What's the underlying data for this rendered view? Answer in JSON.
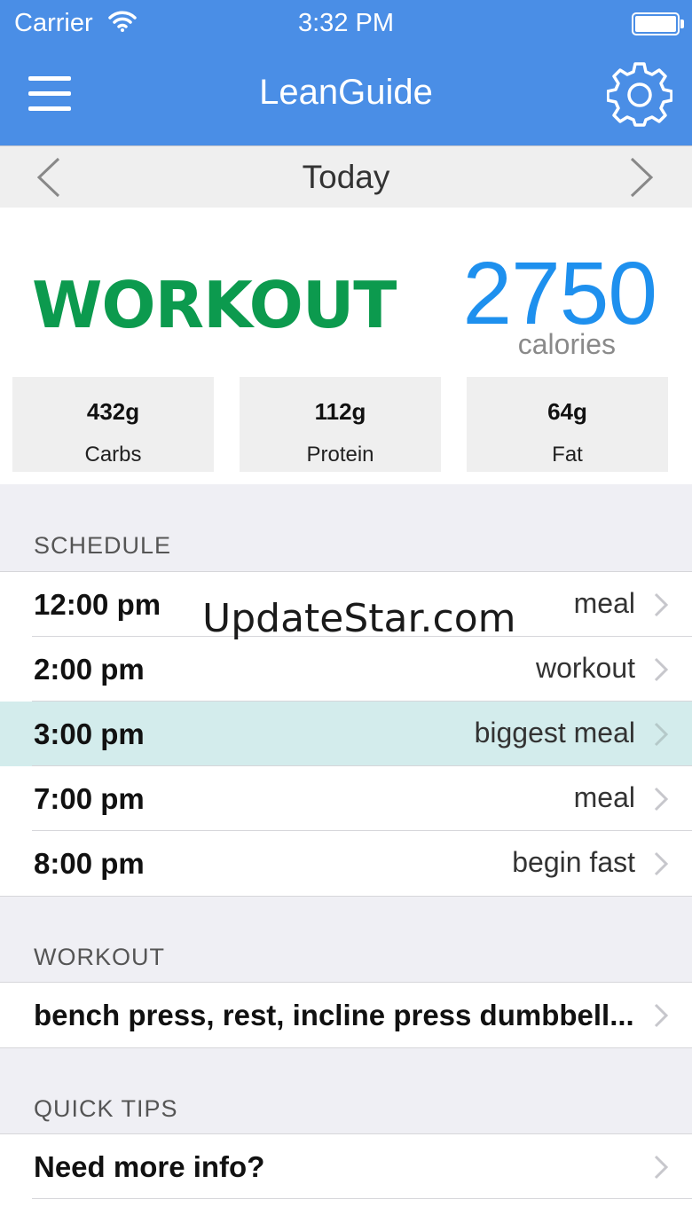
{
  "status_bar": {
    "carrier": "Carrier",
    "time": "3:32 PM"
  },
  "nav": {
    "title": "LeanGuide"
  },
  "date_bar": {
    "label": "Today"
  },
  "summary": {
    "mode": "WORKOUT",
    "calories_value": "2750",
    "calories_unit": "calories",
    "macros": [
      {
        "amount": "432g",
        "name": "Carbs"
      },
      {
        "amount": "112g",
        "name": "Protein"
      },
      {
        "amount": "64g",
        "name": "Fat"
      }
    ]
  },
  "schedule": {
    "header": "SCHEDULE",
    "rows": [
      {
        "time": "12:00 pm",
        "label": "meal"
      },
      {
        "time": "2:00 pm",
        "label": "workout"
      },
      {
        "time": "3:00 pm",
        "label": "biggest meal"
      },
      {
        "time": "7:00 pm",
        "label": "meal"
      },
      {
        "time": "8:00 pm",
        "label": "begin fast"
      }
    ]
  },
  "workout": {
    "header": "WORKOUT",
    "row": "bench press, rest, incline press dumbbell..."
  },
  "tips": {
    "header": "QUICK TIPS",
    "row": "Need more info?"
  },
  "watermark": "UpdateStar.com",
  "colors": {
    "nav": "#4a8ee6",
    "mode": "#0c9a4e",
    "calories": "#1e90ee",
    "highlight_row": "#d3ecec"
  }
}
